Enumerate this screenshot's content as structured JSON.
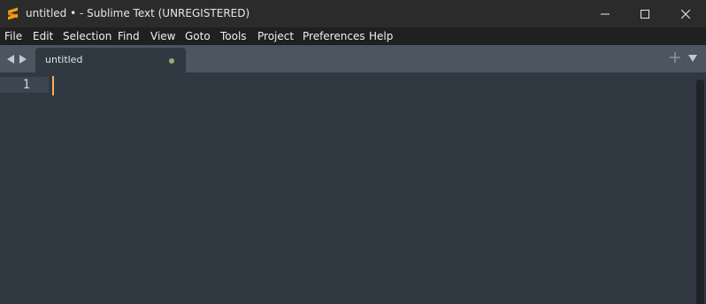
{
  "window": {
    "title": "untitled • - Sublime Text (UNREGISTERED)"
  },
  "menu": [
    {
      "label": "File"
    },
    {
      "label": "Edit"
    },
    {
      "label": "Selection"
    },
    {
      "label": "Find"
    },
    {
      "label": "View"
    },
    {
      "label": "Goto"
    },
    {
      "label": "Tools"
    },
    {
      "label": "Project"
    },
    {
      "label": "Preferences"
    },
    {
      "label": "Help"
    }
  ],
  "tabs": [
    {
      "label": "untitled",
      "dirty": true
    }
  ],
  "editor": {
    "line_numbers": [
      "1"
    ],
    "content": ""
  },
  "icons": {
    "app": "sublime-logo-icon",
    "minimize": "minimize-icon",
    "maximize": "maximize-icon",
    "close": "close-icon",
    "nav_back": "triangle-left-icon",
    "nav_forward": "triangle-right-icon",
    "new_tab": "plus-icon",
    "tab_list": "triangle-down-icon"
  },
  "colors": {
    "titlebar": "#2b2b2b",
    "menubar": "#202020",
    "tabstrip": "#4b5661",
    "editor_bg": "#303841",
    "caret": "#f9ae58",
    "dirty_dot": "#8fb070",
    "logo": "#f59b14"
  }
}
